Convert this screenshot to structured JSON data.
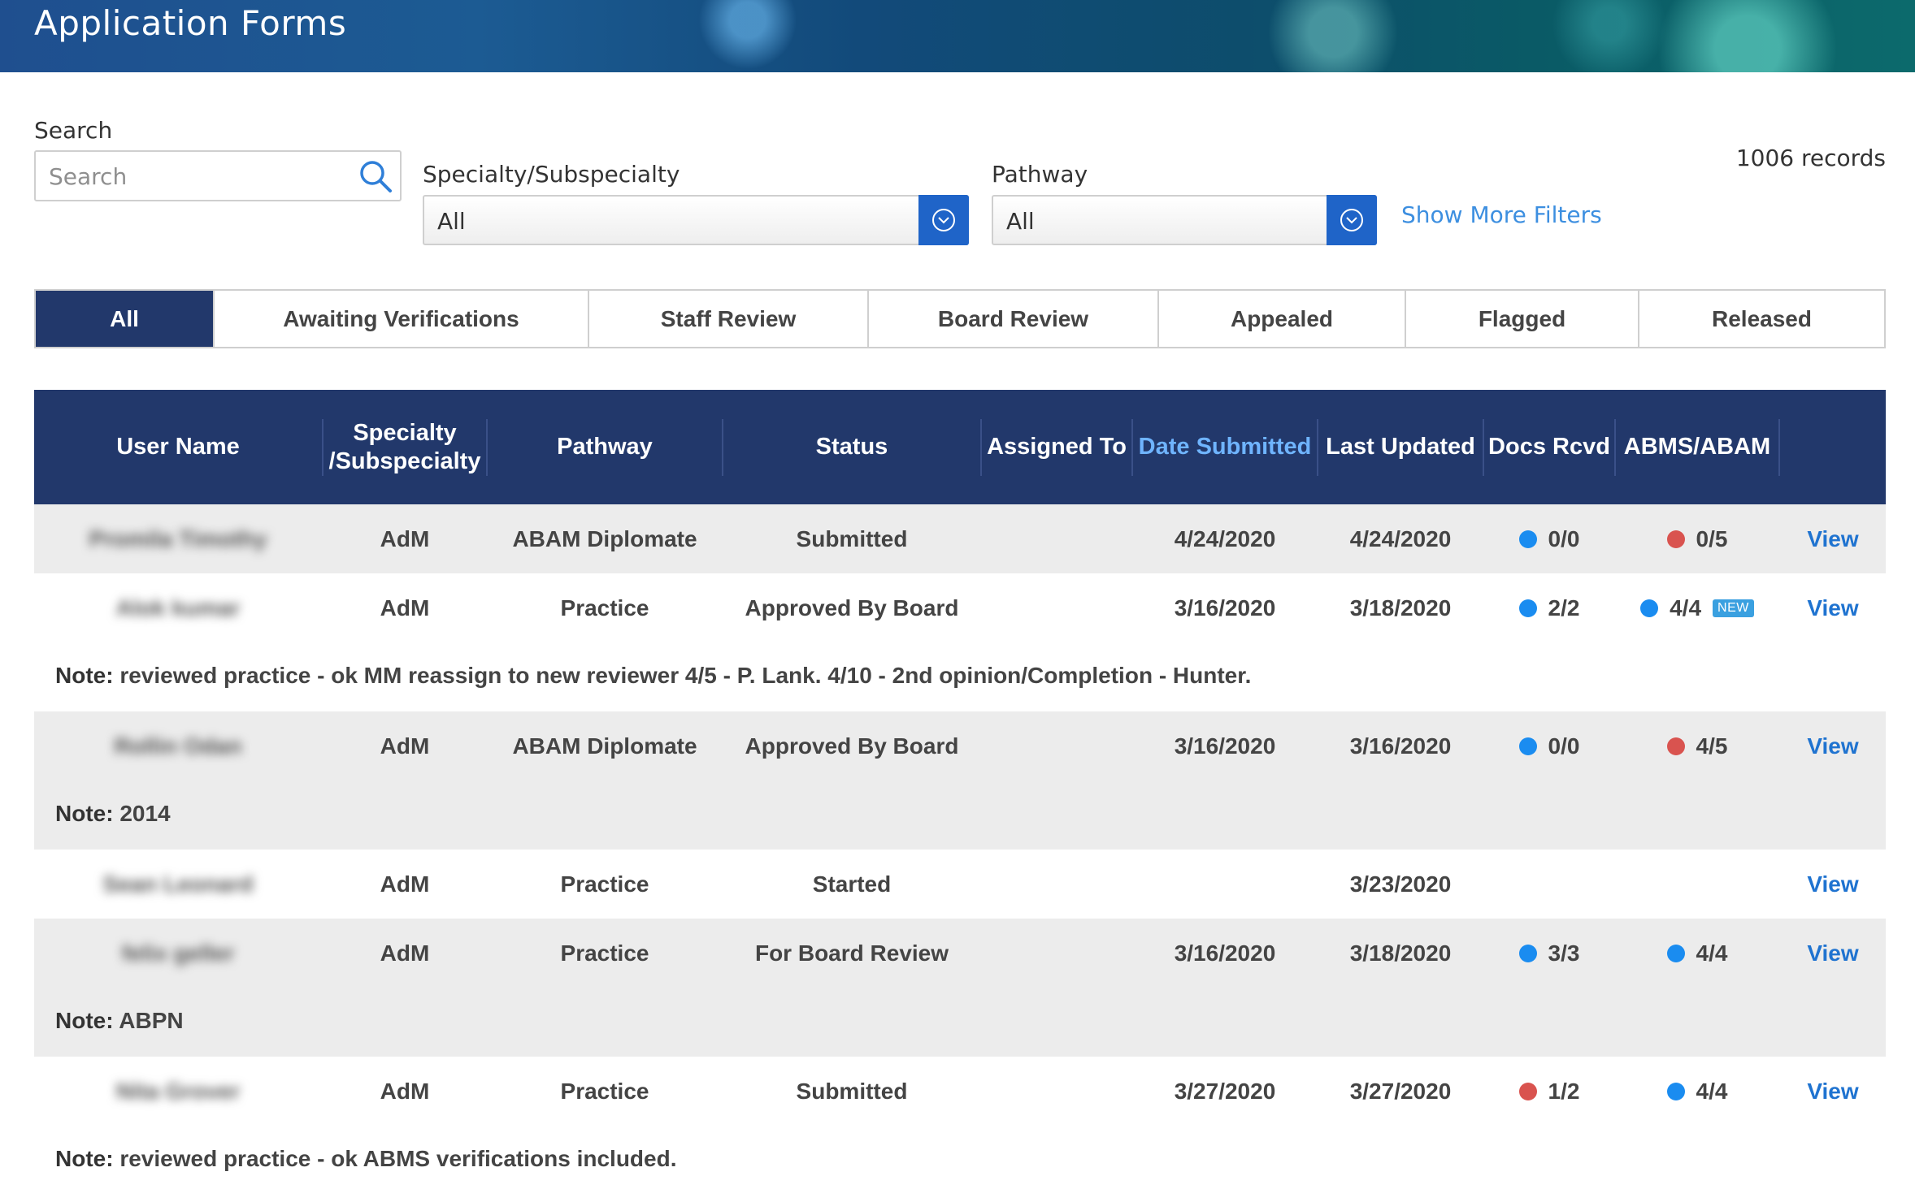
{
  "header": {
    "title": "Application Forms"
  },
  "filters": {
    "search_label": "Search",
    "search_placeholder": "Search",
    "specialty_label": "Specialty/Subspecialty",
    "specialty_value": "All",
    "pathway_label": "Pathway",
    "pathway_value": "All",
    "more_filters": "Show More Filters",
    "records": "1006 records"
  },
  "tabs": [
    {
      "label": "All",
      "active": true
    },
    {
      "label": "Awaiting Verifications"
    },
    {
      "label": "Staff Review"
    },
    {
      "label": "Board Review"
    },
    {
      "label": "Appealed"
    },
    {
      "label": "Flagged"
    },
    {
      "label": "Released"
    }
  ],
  "table": {
    "columns": {
      "user_name": "User Name",
      "specialty_line1": "Specialty",
      "specialty_line2": "/Subspecialty",
      "pathway": "Pathway",
      "status": "Status",
      "assigned_to": "Assigned To",
      "date_submitted": "Date Submitted",
      "last_updated": "Last Updated",
      "docs_rcvd": "Docs Rcvd",
      "abms": "ABMS/ABAM"
    },
    "view_label": "View",
    "note_label": "Note:",
    "rows": [
      {
        "name": "Promila Timothy",
        "specialty": "AdM",
        "pathway": "ABAM Diplomate",
        "status": "Submitted",
        "assigned": "",
        "submitted": "4/24/2020",
        "updated": "4/24/2020",
        "docs": "0/0",
        "docs_color": "#1a8cf0",
        "abms": "0/5",
        "abms_color": "#d9534f",
        "badge": "",
        "note": ""
      },
      {
        "name": "Alok kumar",
        "specialty": "AdM",
        "pathway": "Practice",
        "status": "Approved By Board",
        "assigned": "",
        "submitted": "3/16/2020",
        "updated": "3/18/2020",
        "docs": "2/2",
        "docs_color": "#1a8cf0",
        "abms": "4/4",
        "abms_color": "#1a8cf0",
        "badge": "NEW",
        "note": "reviewed practice - ok MM reassign to new reviewer 4/5 - P. Lank. 4/10 - 2nd opinion/Completion - Hunter."
      },
      {
        "name": "Rollin Odan",
        "specialty": "AdM",
        "pathway": "ABAM Diplomate",
        "status": "Approved By Board",
        "assigned": "",
        "submitted": "3/16/2020",
        "updated": "3/16/2020",
        "docs": "0/0",
        "docs_color": "#1a8cf0",
        "abms": "4/5",
        "abms_color": "#d9534f",
        "badge": "",
        "note": "2014"
      },
      {
        "name": "Sean Leonard",
        "specialty": "AdM",
        "pathway": "Practice",
        "status": "Started",
        "assigned": "",
        "submitted": "",
        "updated": "3/23/2020",
        "docs": "",
        "docs_color": "",
        "abms": "",
        "abms_color": "",
        "badge": "",
        "note": ""
      },
      {
        "name": "felix geller",
        "specialty": "AdM",
        "pathway": "Practice",
        "status": "For Board Review",
        "assigned": "",
        "submitted": "3/16/2020",
        "updated": "3/18/2020",
        "docs": "3/3",
        "docs_color": "#1a8cf0",
        "abms": "4/4",
        "abms_color": "#1a8cf0",
        "badge": "",
        "note": "ABPN"
      },
      {
        "name": "Nita Grover",
        "specialty": "AdM",
        "pathway": "Practice",
        "status": "Submitted",
        "assigned": "",
        "submitted": "3/27/2020",
        "updated": "3/27/2020",
        "docs": "1/2",
        "docs_color": "#d9534f",
        "abms": "4/4",
        "abms_color": "#1a8cf0",
        "badge": "",
        "note": "reviewed practice - ok ABMS verifications included."
      }
    ]
  }
}
